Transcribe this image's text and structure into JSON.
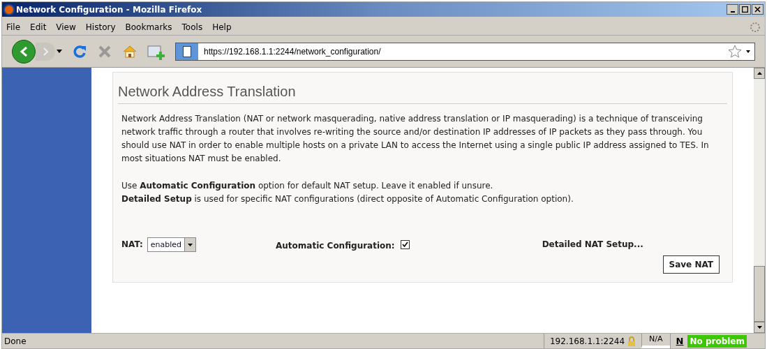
{
  "window": {
    "title": "Network Configuration - Mozilla Firefox"
  },
  "menu": [
    "File",
    "Edit",
    "View",
    "History",
    "Bookmarks",
    "Tools",
    "Help"
  ],
  "address_bar": {
    "value": "https://192.168.1.1:2244/network_configuration/"
  },
  "section": {
    "title": "Network Address Translation",
    "paragraphs": [
      "Network Address Translation (NAT or network masquerading, native address translation or IP masquerading) is a technique of transceiving network traffic through a router that involves re-writing the source and/or destination IP addresses of IP packets as they pass through. You should use NAT in order to enable multiple hosts on a private LAN to access the Internet using a single public IP address assigned to TES. In most situations NAT must be enabled."
    ],
    "notes": [
      "Use **Automatic Configuration** option for default NAT setup. Leave it enabled if unsure.",
      "**Detailed Setup** is used for specific NAT configurations (direct opposite of Automatic Configuration option)."
    ],
    "nat": {
      "label": "NAT:",
      "value": "enabled"
    },
    "auto_config": {
      "label": "Automatic Configuration:",
      "checked": true
    },
    "detailed_link": "Detailed NAT Setup...",
    "save_button": "Save NAT"
  },
  "status_bar": {
    "text": "Done",
    "host": "192.168.1.1:2244",
    "na": "N/A",
    "logo": "N",
    "status": "No problem"
  }
}
